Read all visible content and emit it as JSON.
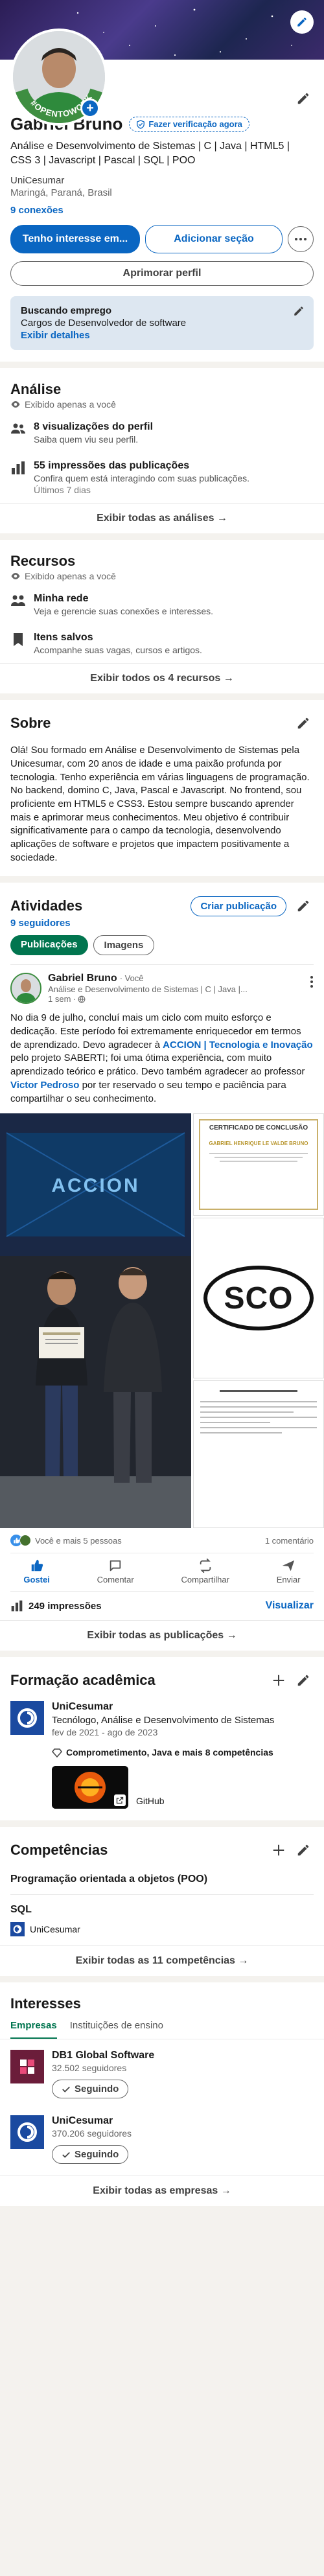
{
  "profile": {
    "name": "Gabriel Bruno",
    "verify_label": "Fazer verificação agora",
    "headline": "Análise e Desenvolvimento de Sistemas | C | Java | HTML5 | CSS 3 | Javascript | Pascal | SQL | POO",
    "school": "UniCesumar",
    "location": "Maringá, Paraná, Brasil",
    "connections": "9 conexões",
    "open_to_work": "#OPENTOWORK",
    "btn_interest": "Tenho interesse em...",
    "btn_add_section": "Adicionar seção",
    "btn_improve": "Aprimorar perfil",
    "job_card_title": "Buscando emprego",
    "job_card_sub": "Cargos de Desenvolvedor de software",
    "job_card_link": "Exibir detalhes"
  },
  "analysis": {
    "title": "Análise",
    "private": "Exibido apenas a você",
    "items": [
      {
        "title": "8 visualizações do perfil",
        "sub": "Saiba quem viu seu perfil.",
        "extra": ""
      },
      {
        "title": "55 impressões das publicações",
        "sub": "Confira quem está interagindo com suas publicações.",
        "extra": "Últimos 7 dias"
      }
    ],
    "footer": "Exibir todas as análises →"
  },
  "resources": {
    "title": "Recursos",
    "private": "Exibido apenas a você",
    "items": [
      {
        "title": "Minha rede",
        "sub": "Veja e gerencie suas conexões e interesses."
      },
      {
        "title": "Itens salvos",
        "sub": "Acompanhe suas vagas, cursos e artigos."
      }
    ],
    "footer": "Exibir todos os 4 recursos →"
  },
  "about": {
    "title": "Sobre",
    "text": "Olá! Sou formado em Análise e Desenvolvimento de Sistemas pela Unicesumar, com 20 anos de idade e uma paixão profunda por tecnologia. Tenho experiência em várias linguagens de programação. No backend, domino C, Java, Pascal e Javascript. No frontend, sou proficiente em HTML5 e CSS3. Estou sempre buscando aprender mais e aprimorar meus conhecimentos. Meu objetivo é contribuir significativamente para o campo da tecnologia, desenvolvendo aplicações de software e projetos que impactem positivamente a sociedade."
  },
  "activity": {
    "title": "Atividades",
    "followers": "9 seguidores",
    "create_post": "Criar publicação",
    "tab_posts": "Publicações",
    "tab_images": "Imagens",
    "post": {
      "author": "Gabriel Bruno",
      "you": "· Você",
      "headline": "Análise e Desenvolvimento de Sistemas | C | Java |...",
      "time": "1 sem · ",
      "text_1": "No dia 9 de julho, concluí mais um ciclo com muito esforço e dedicação. Este período foi extremamente enriquecedor em termos de aprendizado. Devo agradecer à ",
      "link_1": "ACCION | Tecnologia e Inovação",
      "text_2": " pelo projeto SABERTI; foi uma ótima experiência, com muito aprendizado teórico e prático. Devo também agradecer ao professor ",
      "link_2": "Victor Pedroso",
      "text_3": " por ter reservado o seu tempo e paciência para compartilhar o seu conhecimento.",
      "cert_title": "CERTIFICADO DE CONCLUSÃO",
      "cert_name": "GABRIEL HENRIQUE LE VALDE BRUNO",
      "sco_label": "SCO",
      "photo_banner": "ACCION",
      "reactions": "Você e mais 5 pessoas",
      "comments": "1 comentário",
      "act_like": "Gostei",
      "act_comment": "Comentar",
      "act_share": "Compartilhar",
      "act_send": "Enviar",
      "impressions": "249 impressões",
      "view": "Visualizar"
    },
    "footer": "Exibir todas as publicações →"
  },
  "education": {
    "title": "Formação acadêmica",
    "school": "UniCesumar",
    "degree": "Tecnólogo, Análise e Desenvolvimento de Sistemas",
    "dates": "fev de 2021 - ago de 2023",
    "skills": "Comprometimento, Java e mais 8 competências",
    "media": "GitHub"
  },
  "skills": {
    "title": "Competências",
    "items": [
      {
        "name": "Programação orientada a objetos (POO)",
        "source": ""
      },
      {
        "name": "SQL",
        "source": "UniCesumar"
      }
    ],
    "footer": "Exibir todas as 11 competências →"
  },
  "interests": {
    "title": "Interesses",
    "tab_companies": "Empresas",
    "tab_schools": "Instituições de ensino",
    "items": [
      {
        "name": "DB1 Global Software",
        "followers": "32.502 seguidores",
        "btn": "Seguindo"
      },
      {
        "name": "UniCesumar",
        "followers": "370.206 seguidores",
        "btn": "Seguindo"
      }
    ],
    "footer": "Exibir todas as empresas →"
  },
  "colors": {
    "brand": "#0a66c2",
    "green": "#01754f",
    "bg": "#f4f2ee"
  }
}
